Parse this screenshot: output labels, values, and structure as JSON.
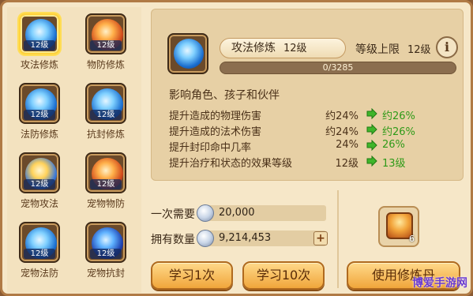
{
  "skills": [
    {
      "name": "攻法修炼",
      "level": "12级",
      "orb": "blue",
      "selected": true
    },
    {
      "name": "物防修炼",
      "level": "12级",
      "orb": "red",
      "selected": false
    },
    {
      "name": "法防修炼",
      "level": "12级",
      "orb": "blue",
      "selected": false
    },
    {
      "name": "抗封修炼",
      "level": "12级",
      "orb": "blue",
      "selected": false
    },
    {
      "name": "宠物攻法",
      "level": "12级",
      "orb": "gold",
      "selected": false
    },
    {
      "name": "宠物物防",
      "level": "12级",
      "orb": "red",
      "selected": false
    },
    {
      "name": "宠物法防",
      "level": "12级",
      "orb": "blue",
      "selected": false
    },
    {
      "name": "宠物抗封",
      "level": "12级",
      "orb": "dblue",
      "selected": false
    }
  ],
  "detail": {
    "title": "攻法修炼",
    "level": "12级",
    "limit_label": "等级上限",
    "limit_level": "12级",
    "info_icon": "i",
    "exp_text": "0/3285",
    "exp_fraction": 0,
    "section_title": "影响角色、孩子和伙伴",
    "effects": [
      {
        "label": "提升造成的物理伤害",
        "current": "约24%",
        "next": "约26%"
      },
      {
        "label": "提升造成的法术伤害",
        "current": "约24%",
        "next": "约26%"
      },
      {
        "label": "提升封印命中几率",
        "current": "24%",
        "next": "26%"
      },
      {
        "label": "提升治疗和状态的效果等级",
        "current": "12级",
        "next": "13级"
      }
    ]
  },
  "cost": {
    "need_label": "一次需要",
    "need_value": "20,000",
    "own_label": "拥有数量",
    "own_value": "9,214,453",
    "plus": "+"
  },
  "buttons": {
    "learn1": "学习1次",
    "learn10": "学习10次",
    "use_item": "使用修炼丹"
  },
  "item": {
    "count": "6"
  },
  "watermark": "博爱手游网",
  "colors": {
    "accent": "#f0a63b",
    "next_value": "#2f9a18",
    "panel": "#f6e7c8"
  }
}
